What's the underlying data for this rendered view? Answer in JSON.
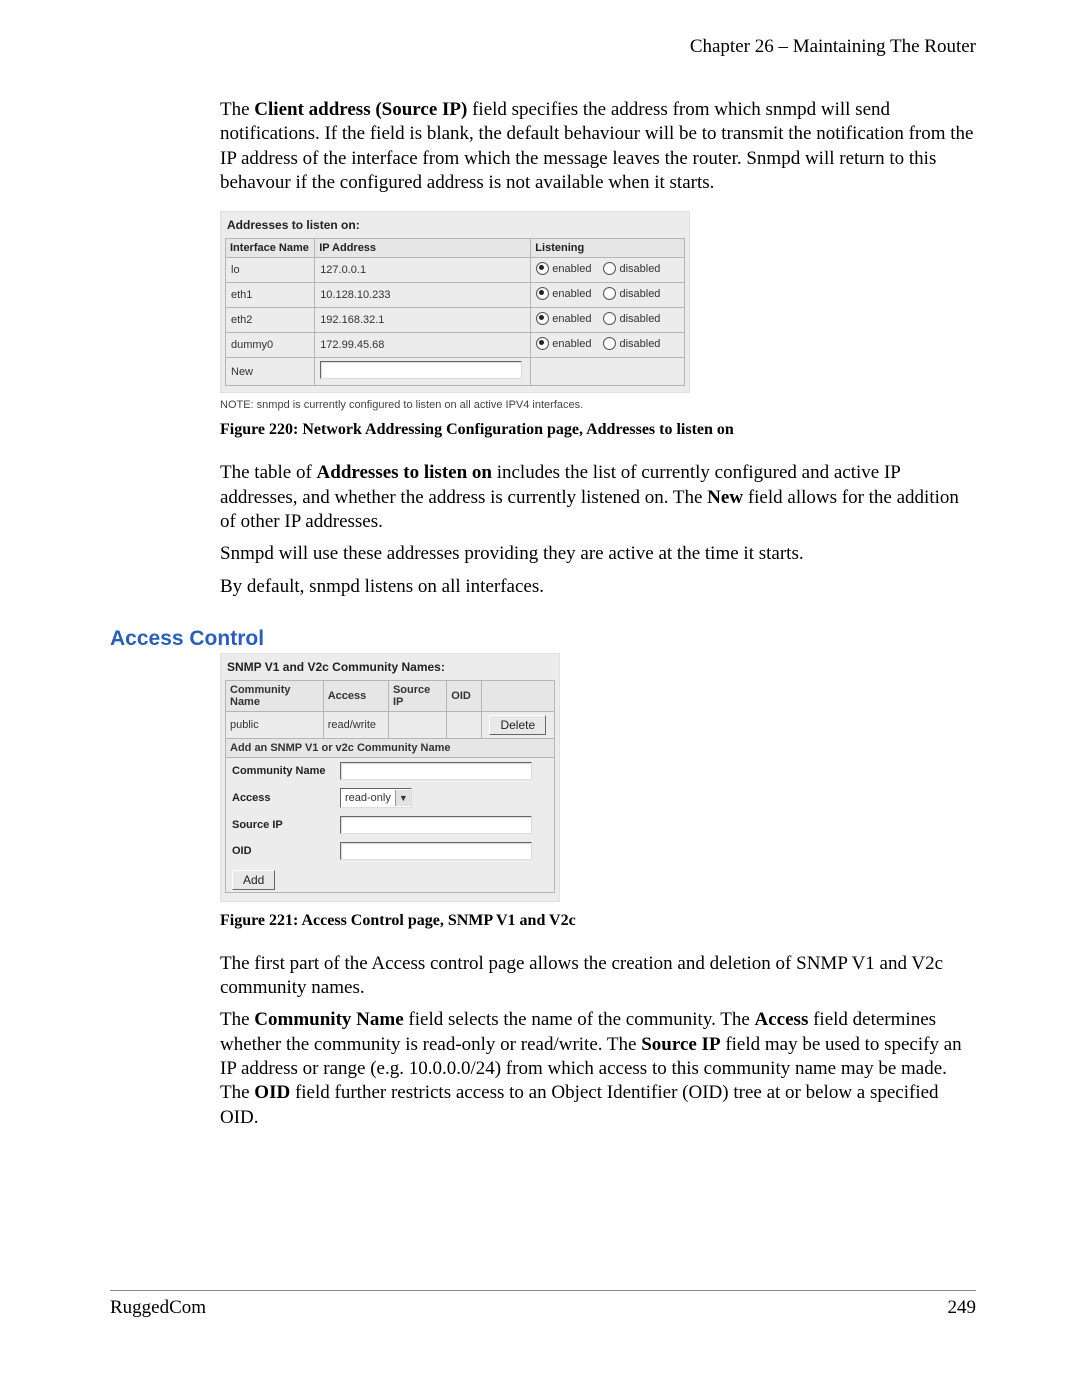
{
  "header": {
    "chapter": "Chapter 26 – Maintaining The Router"
  },
  "para1": {
    "pre": "The ",
    "bold": "Client address (Source IP)",
    "post": " field specifies the address from which snmpd will send notifications.  If the field is blank, the default behaviour will be to transmit the notification from the IP address of the interface from which the message leaves the router.  Snmpd will return to this behavour if the configured address is not available when it starts."
  },
  "panel1": {
    "title": "Addresses to listen on:",
    "cols": {
      "if": "Interface Name",
      "ip": "IP Address",
      "listen": "Listening"
    },
    "radio": {
      "enabledLabel": "enabled",
      "disabledLabel": "disabled"
    },
    "rows": [
      {
        "if": "lo",
        "ip": "127.0.0.1"
      },
      {
        "if": "eth1",
        "ip": "10.128.10.233"
      },
      {
        "if": "eth2",
        "ip": "192.168.32.1"
      },
      {
        "if": "dummy0",
        "ip": "172.99.45.68"
      }
    ],
    "newLabel": "New"
  },
  "note": "NOTE: snmpd is currently configured to listen on all active IPV4 interfaces.",
  "cap1": "Figure 220: Network Addressing Configuration page,  Addresses to listen on",
  "para2": {
    "a": "The table of ",
    "b": "Addresses to listen on",
    "c": " includes the list of currently configured and active IP addresses, and whether  the address is currently listened on.  The ",
    "d": "New",
    "e": " field allows for the addition of other IP addresses."
  },
  "para3": "Snmpd will use these addresses providing they are active at the time it starts.",
  "para4": "By default, snmpd listens on all interfaces.",
  "section": "Access Control",
  "panel2": {
    "title": "SNMP V1 and V2c Community Names:",
    "cols": {
      "name": "Community Name",
      "access": "Access",
      "src": "Source IP",
      "oid": "OID"
    },
    "row0": {
      "name": "public",
      "access": "read/write",
      "src": "",
      "oid": "",
      "del": "Delete"
    },
    "addHead": "Add an SNMP V1 or v2c Community Name",
    "labels": {
      "name": "Community Name",
      "access": "Access",
      "src": "Source IP",
      "oid": "OID"
    },
    "selValue": "read-only",
    "addBtn": "Add"
  },
  "cap2": "Figure 221: Access Control page, SNMP V1 and V2c",
  "para5": "The first part of the Access control page allows the creation and deletion of SNMP V1 and V2c community names.",
  "para6": {
    "a": "The ",
    "b": "Community Name",
    "c": " field selects the name of the community.  The ",
    "d": "Access",
    "e": " field determines whether the community is read-only or read/write.  The ",
    "f": "Source IP",
    "g": " field may be used to specify an IP address or range (e.g. 10.0.0.0/24) from which access to this community name may be made.  The ",
    "h": "OID",
    "i": " field further restricts access to an Object Identifier (OID) tree at or below a specified OID."
  },
  "footer": {
    "left": "RuggedCom",
    "right": "249"
  }
}
